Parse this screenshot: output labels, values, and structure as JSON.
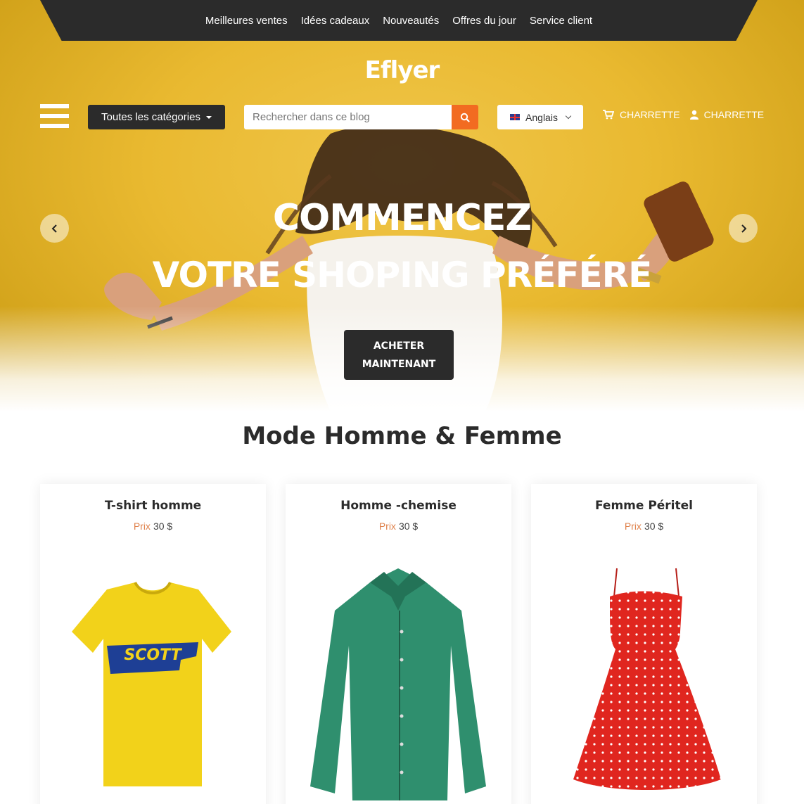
{
  "topnav": {
    "items": [
      "Meilleures ventes",
      "Idées cadeaux",
      "Nouveautés",
      "Offres du jour",
      "Service client"
    ]
  },
  "header": {
    "logo": "Eflyer",
    "categories_label": "Toutes les catégories",
    "search_placeholder": "Rechercher dans ce blog",
    "language": "Anglais",
    "cart_label": "CHARRETTE",
    "account_label": "CHARRETTE"
  },
  "hero": {
    "line1": "COMMENCEZ",
    "line2": "VOTRE SHOPING PRÉFÉRÉ",
    "cta": "ACHETER MAINTENANT",
    "colors": {
      "background": "#e9b930",
      "button": "#2b2b2b"
    }
  },
  "section": {
    "title": "Mode Homme & Femme"
  },
  "products": [
    {
      "name": "T-shirt homme",
      "price_label": "Prix",
      "price": "30 $",
      "image": "yellow-tshirt"
    },
    {
      "name": "Homme -chemise",
      "price_label": "Prix",
      "price": "30 $",
      "image": "green-shirt"
    },
    {
      "name": "Femme Péritel",
      "price_label": "Prix",
      "price": "30 $",
      "image": "red-dress"
    }
  ],
  "icons": [
    "menu-icon",
    "search-icon",
    "flag-icon",
    "chevron-down-icon",
    "cart-icon",
    "user-icon",
    "chevron-left-icon",
    "chevron-right-icon"
  ],
  "accent_color": "#f26b21"
}
